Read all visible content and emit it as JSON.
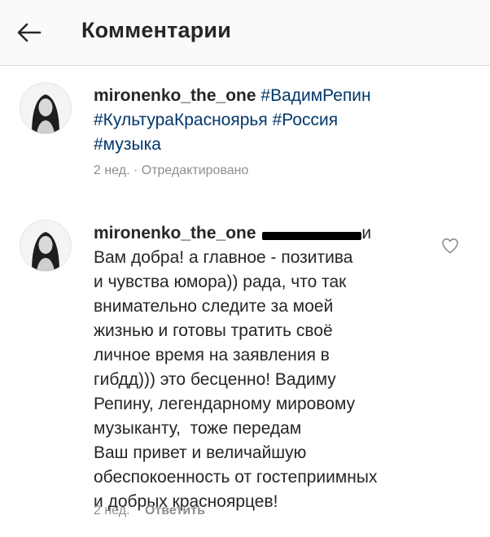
{
  "header": {
    "title": "Комментарии",
    "back_icon": "arrow-left-icon"
  },
  "comments": [
    {
      "username": "mironenko_the_one",
      "hashtags": [
        "#ВадимРепин",
        "#КультураКрасноярья",
        "#Россия",
        "#музыка"
      ],
      "time": "2 нед.",
      "separator": "·",
      "edited": "Отредактировано"
    },
    {
      "username": "mironenko_the_one",
      "mention_suffix": "и",
      "lines": [
        "Вам добра! а главное - позитива",
        "и чувства юмора)) рада, что так",
        "внимательно следите за моей",
        "жизнью и готовы тратить своё",
        "личное время на заявления в",
        "гибдд))) это бесценно! Вадиму",
        "Репину, легендарному мировому",
        "музыканту,  тоже передам",
        "Ваш привет и величайшую",
        "обеспокоенность от гостеприимных",
        "и добрых красноярцев!"
      ],
      "time": "2 нед.",
      "reply_label": "Ответить",
      "like_icon": "heart-outline-icon"
    }
  ]
}
